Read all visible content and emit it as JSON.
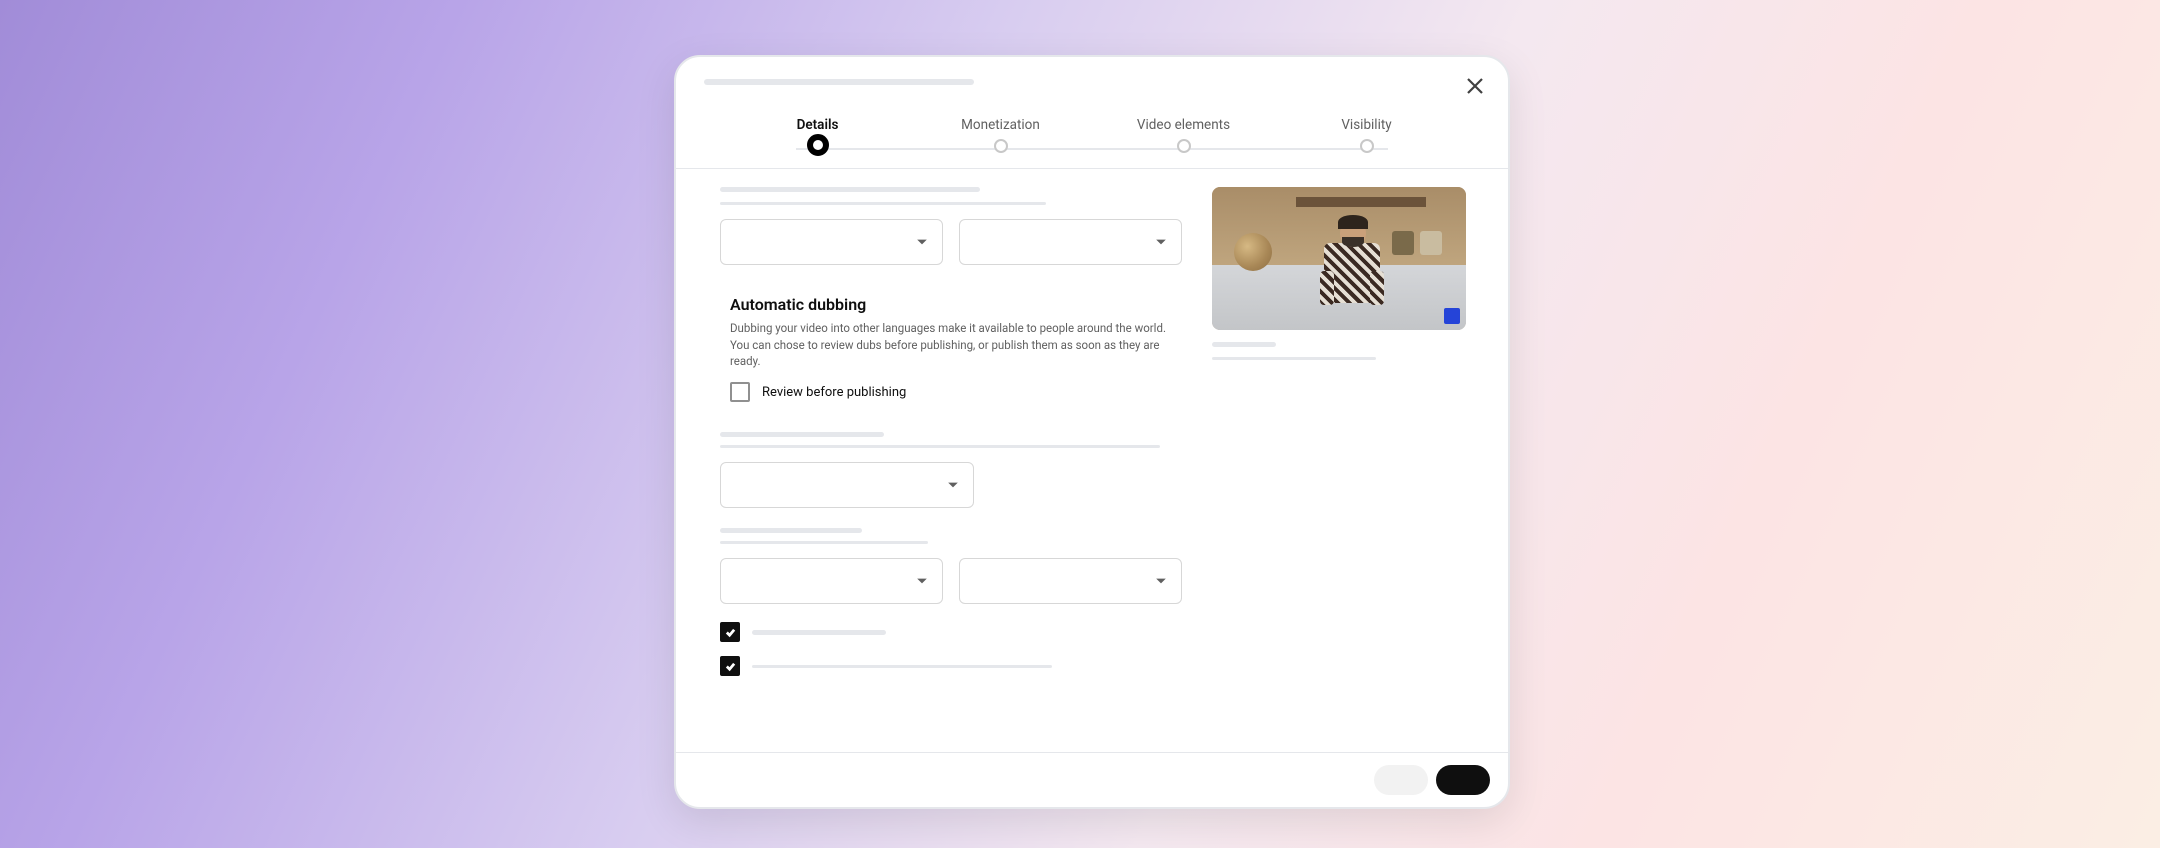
{
  "steps": [
    {
      "label": "Details"
    },
    {
      "label": "Monetization"
    },
    {
      "label": "Video elements"
    },
    {
      "label": "Visibility"
    }
  ],
  "dubbing": {
    "title": "Automatic dubbing",
    "description": "Dubbing your video into other languages make it available to people around the world. You can chose to review dubs before publishing, or publish them as soon as they are ready.",
    "checkbox_label": "Review before publishing"
  }
}
